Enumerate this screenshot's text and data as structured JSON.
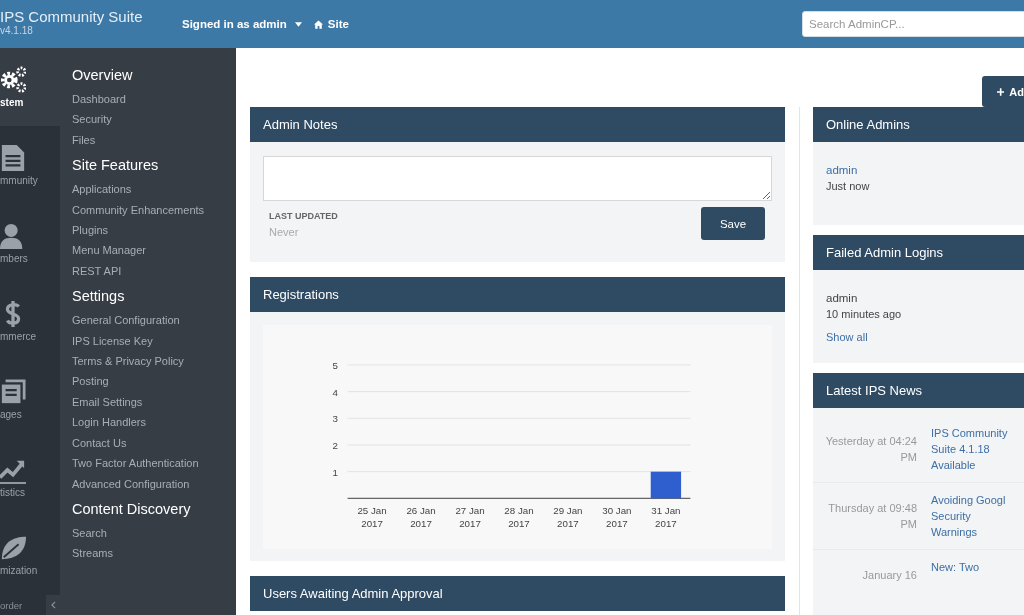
{
  "header": {
    "brand": "IPS Community Suite",
    "version": "v4.1.18",
    "user_menu": "Signed in as admin",
    "site_link": "Site",
    "search": {
      "placeholder": "Search AdminCP..."
    }
  },
  "app_tabs": [
    {
      "label": "stem",
      "selected": true
    },
    {
      "label": "mmunity",
      "selected": false
    },
    {
      "label": "mbers",
      "selected": false
    },
    {
      "label": "mmerce",
      "selected": false
    },
    {
      "label": "ages",
      "selected": false
    },
    {
      "label": "tistics",
      "selected": false
    },
    {
      "label": "mization",
      "selected": false
    }
  ],
  "app_tabs_footer": "order",
  "submenu": [
    {
      "title": "Overview",
      "items": [
        "Dashboard",
        "Security",
        "Files"
      ]
    },
    {
      "title": "Site Features",
      "items": [
        "Applications",
        "Community Enhancements",
        "Plugins",
        "Menu Manager",
        "REST API"
      ]
    },
    {
      "title": "Settings",
      "items": [
        "General Configuration",
        "IPS License Key",
        "Terms & Privacy Policy",
        "Posting",
        "Email Settings",
        "Login Handlers",
        "Contact Us",
        "Two Factor Authentication",
        "Advanced Configuration"
      ]
    },
    {
      "title": "Content Discovery",
      "items": [
        "Search",
        "Streams"
      ]
    }
  ],
  "add_button": "Ad",
  "admin_notes": {
    "title": "Admin Notes",
    "last_updated_label": "LAST UPDATED",
    "last_updated": "Never",
    "save": "Save"
  },
  "registrations": {
    "title": "Registrations",
    "chart_data": {
      "type": "bar",
      "categories": [
        "25 Jan 2017",
        "26 Jan 2017",
        "27 Jan 2017",
        "28 Jan 2017",
        "29 Jan 2017",
        "30 Jan 2017",
        "31 Jan 2017"
      ],
      "series": [
        {
          "color": "#2f5fce",
          "values": [
            0,
            0,
            0,
            0,
            0,
            0,
            1
          ]
        }
      ],
      "ylim": [
        0,
        5
      ],
      "yticks": [
        1,
        2,
        3,
        4,
        5
      ],
      "grid": true
    }
  },
  "users_awaiting": {
    "title": "Users Awaiting Admin Approval"
  },
  "online_admins": {
    "title": "Online Admins",
    "entries": [
      {
        "name": "admin",
        "time": "Just now"
      }
    ]
  },
  "failed_logins": {
    "title": "Failed Admin Logins",
    "entries": [
      {
        "name": "admin",
        "time": "10 minutes ago"
      }
    ],
    "show_all": "Show all"
  },
  "news": {
    "title": "Latest IPS News",
    "items": [
      {
        "date": "Yesterday at 04:24 PM",
        "title": "IPS Community Suite 4.1.18 Available"
      },
      {
        "date": "Thursday at 09:48 PM",
        "title": "Avoiding Googl Security Warnings"
      },
      {
        "date": "January 16",
        "title": "New: Two"
      }
    ]
  }
}
